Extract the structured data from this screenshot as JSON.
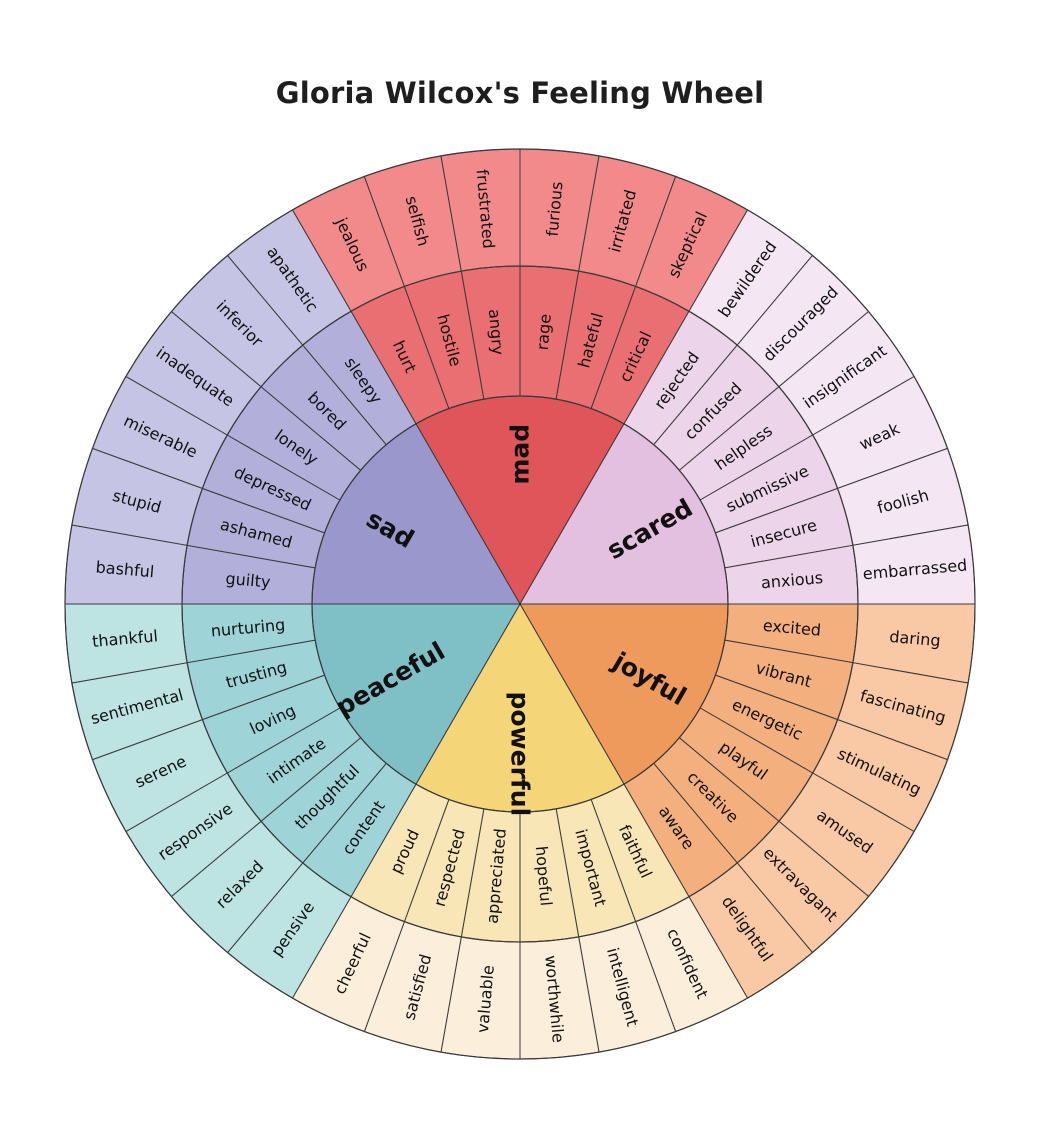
{
  "title": "Gloria Wilcox's Feeling Wheel",
  "wheel": {
    "cores": [
      {
        "label": "mad",
        "color": "#e05559",
        "mid_color": "#ea6f72",
        "outer_color": "#f28a8c",
        "middle": [
          "hurt",
          "hostile",
          "angry",
          "rage",
          "hateful",
          "critical"
        ],
        "outer": [
          "jealous",
          "selfish",
          "frustrated",
          "furious",
          "irritated",
          "skeptical"
        ]
      },
      {
        "label": "scared",
        "color": "#e3bfe0",
        "mid_color": "#ecd4ea",
        "outer_color": "#f4e6f3",
        "middle": [
          "rejected",
          "confused",
          "helpless",
          "submissive",
          "insecure",
          "anxious"
        ],
        "outer": [
          "bewildered",
          "discouraged",
          "insignificant",
          "weak",
          "foolish",
          "embarrassed"
        ]
      },
      {
        "label": "joyful",
        "color": "#ee9a5c",
        "mid_color": "#f3b07e",
        "outer_color": "#f8c9a4",
        "middle": [
          "excited",
          "vibrant",
          "energetic",
          "playful",
          "creative",
          "aware"
        ],
        "outer": [
          "daring",
          "fascinating",
          "stimulating",
          "amused",
          "extravagant",
          "delightful"
        ]
      },
      {
        "label": "powerful",
        "color": "#f4d578",
        "mid_color": "#f9e6b7",
        "outer_color": "#fbeedb",
        "middle": [
          "faithful",
          "important",
          "hopeful",
          "appreciated",
          "respected",
          "proud"
        ],
        "outer": [
          "confident",
          "intelligent",
          "worthwhile",
          "valuable",
          "satisfied",
          "cheerful"
        ]
      },
      {
        "label": "peaceful",
        "color": "#7fbfc6",
        "mid_color": "#9ed3d7",
        "outer_color": "#bde3e3",
        "middle": [
          "content",
          "thoughtful",
          "intimate",
          "loving",
          "trusting",
          "nurturing"
        ],
        "outer": [
          "pensive",
          "relaxed",
          "responsive",
          "serene",
          "sentimental",
          "thankful"
        ]
      },
      {
        "label": "sad",
        "color": "#9a97cd",
        "mid_color": "#b2b0da",
        "outer_color": "#c6c4e4",
        "middle": [
          "guilty",
          "ashamed",
          "depressed",
          "lonely",
          "bored",
          "sleepy"
        ],
        "outer": [
          "bashful",
          "stupid",
          "miserable",
          "inadequate",
          "inferior",
          "apathetic"
        ]
      }
    ]
  }
}
